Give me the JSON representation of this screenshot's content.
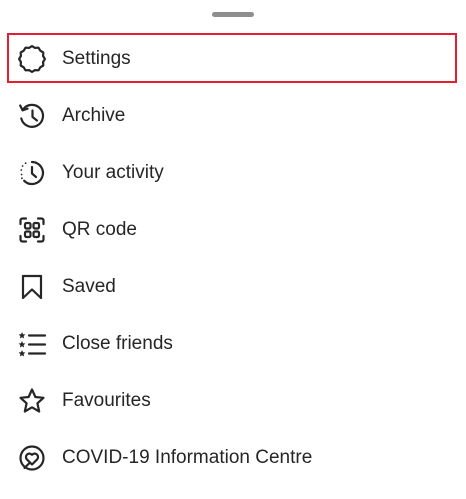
{
  "sheet": {
    "highlight_color": "#e0202e",
    "items": [
      {
        "label": "Settings",
        "icon": "gear-icon"
      },
      {
        "label": "Archive",
        "icon": "archive-icon"
      },
      {
        "label": "Your activity",
        "icon": "activity-icon"
      },
      {
        "label": "QR code",
        "icon": "qr-code-icon"
      },
      {
        "label": "Saved",
        "icon": "bookmark-icon"
      },
      {
        "label": "Close friends",
        "icon": "close-friends-icon"
      },
      {
        "label": "Favourites",
        "icon": "star-icon"
      },
      {
        "label": "COVID-19 Information Centre",
        "icon": "covid-info-icon"
      }
    ]
  }
}
